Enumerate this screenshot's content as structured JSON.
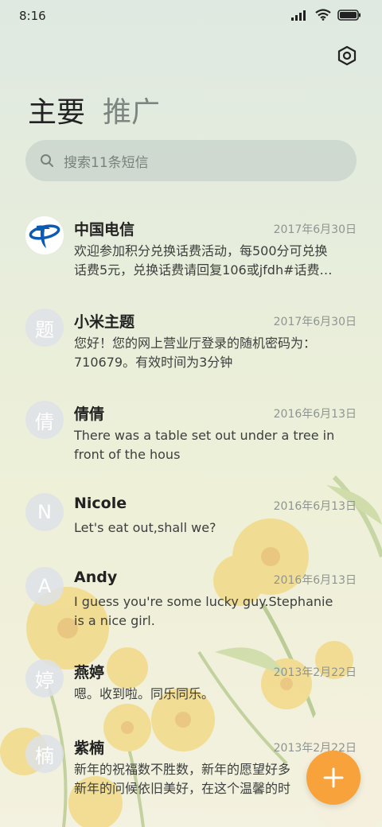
{
  "status_bar": {
    "time": "8:16",
    "icons": [
      "signal-icon",
      "wifi-icon",
      "battery-icon"
    ]
  },
  "header": {
    "settings_icon": "hexagon-settings-icon"
  },
  "tabs": [
    {
      "label": "主要",
      "active": true
    },
    {
      "label": "推广",
      "active": false
    }
  ],
  "search": {
    "placeholder": "搜索11条短信"
  },
  "conversations": [
    {
      "avatar": "",
      "avatar_icon": "china-telecom-logo",
      "name": "中国电信",
      "date": "2017年6月30日",
      "lines": [
        "欢迎参加积分兑换话费活动，每500分可兑换",
        "话费5元，兑换话费请回复106或jfdh#话费…"
      ]
    },
    {
      "avatar": "题",
      "name": "小米主题",
      "date": "2017年6月30日",
      "lines": [
        "您好！您的网上营业厅登录的随机密码为：",
        "710679。有效时间为3分钟"
      ]
    },
    {
      "avatar": "倩",
      "name": "倩倩",
      "date": "2016年6月13日",
      "lines": [
        "There was a table set out under a tree in",
        "front of the hous"
      ]
    },
    {
      "avatar": "N",
      "name": "Nicole",
      "date": "2016年6月13日",
      "lines": [
        "Let's eat out,shall we?"
      ]
    },
    {
      "avatar": "A",
      "name": "Andy",
      "date": "2016年6月13日",
      "lines": [
        "I guess you're some lucky guy.Stephanie",
        "is a nice girl."
      ]
    },
    {
      "avatar": "婷",
      "name": "燕婷",
      "date": "2013年2月22日",
      "lines": [
        "嗯。收到啦。同乐同乐。"
      ]
    },
    {
      "avatar": "楠",
      "name": "紫楠",
      "date": "2013年2月22日",
      "lines": [
        "新年的祝福数不胜数，新年的愿望好多",
        "新年的问候依旧美好，在这个温馨的时"
      ]
    }
  ],
  "fab": {
    "icon": "plus-icon",
    "color": "#f7a23a"
  },
  "colors": {
    "accent": "#f7a23a",
    "avatar_bg": "#dee2e8",
    "text_primary": "#222222",
    "text_secondary": "#8e9590"
  }
}
